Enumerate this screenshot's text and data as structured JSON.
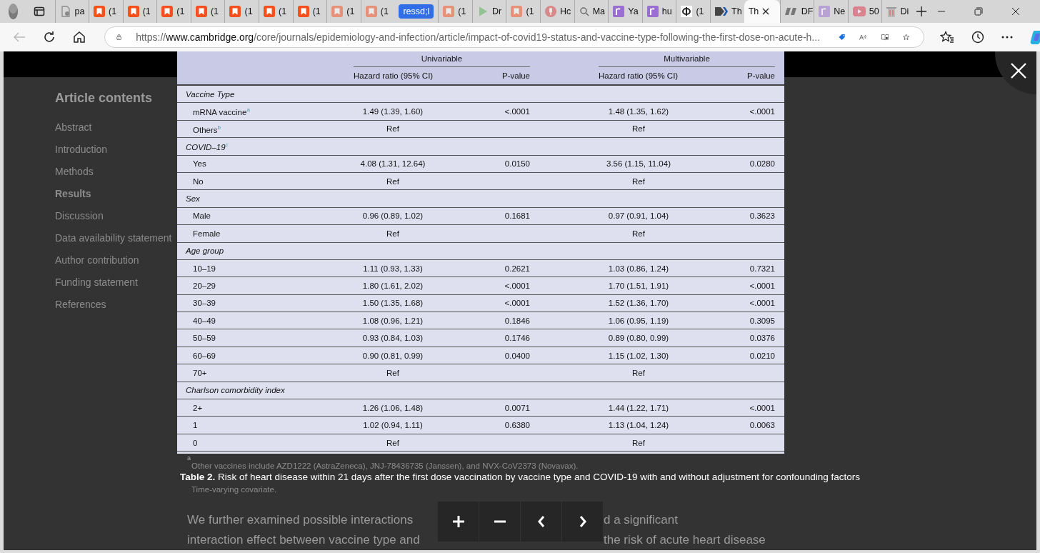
{
  "browser": {
    "tabs": [
      {
        "kind": "doc",
        "title": "pa",
        "sleeping": false,
        "selected": false
      },
      {
        "kind": "bookmark",
        "title": "(1",
        "sleeping": false,
        "selected": false
      },
      {
        "kind": "bookmark",
        "title": "(1",
        "sleeping": false,
        "selected": false
      },
      {
        "kind": "bookmark",
        "title": "(1",
        "sleeping": false,
        "selected": false
      },
      {
        "kind": "bookmark",
        "title": "(1",
        "sleeping": false,
        "selected": false
      },
      {
        "kind": "bookmark",
        "title": "(1",
        "sleeping": false,
        "selected": false
      },
      {
        "kind": "bookmark",
        "title": "(1",
        "sleeping": false,
        "selected": false
      },
      {
        "kind": "bookmark",
        "title": "(1",
        "sleeping": false,
        "selected": false
      },
      {
        "kind": "bookmark",
        "title": "(1",
        "sleeping": true,
        "selected": false
      },
      {
        "kind": "bookmark",
        "title": "(1",
        "sleeping": true,
        "selected": false
      },
      {
        "kind": "group",
        "title": "ressd;l"
      },
      {
        "kind": "bookmark",
        "title": "(1",
        "sleeping": true,
        "selected": false
      },
      {
        "kind": "play",
        "title": "Dr",
        "sleeping": true,
        "selected": false
      },
      {
        "kind": "bookmark",
        "title": "(1",
        "sleeping": true,
        "selected": false
      },
      {
        "kind": "mic",
        "title": "Hc",
        "sleeping": true,
        "selected": false
      },
      {
        "kind": "search",
        "title": "Ma",
        "sleeping": false,
        "selected": false
      },
      {
        "kind": "square",
        "title": "Ya",
        "sleeping": false,
        "selected": false
      },
      {
        "kind": "square",
        "title": "hu",
        "sleeping": false,
        "selected": false
      },
      {
        "kind": "circle",
        "title": "(1",
        "sleeping": false,
        "selected": false
      },
      {
        "kind": "arrow",
        "title": "Th",
        "sleeping": false,
        "selected": false
      },
      {
        "kind": "plain",
        "title": "Th",
        "sleeping": false,
        "selected": true
      },
      {
        "kind": "slant",
        "title": "DF",
        "sleeping": false,
        "selected": false
      },
      {
        "kind": "square",
        "title": "Ne",
        "sleeping": true,
        "selected": false
      },
      {
        "kind": "video",
        "title": "50",
        "sleeping": true,
        "selected": false
      },
      {
        "kind": "bin",
        "title": "Di",
        "sleeping": false,
        "selected": false
      }
    ],
    "back_disabled": true,
    "url": {
      "scheme": "https://",
      "host": "www.cambridge.org",
      "path": "/core/journals/epidemiology-and-infection/article/impact-of-covid19-status-and-vaccine-type-following-the-first-dose-on-acute-h..."
    }
  },
  "sidebar": {
    "title": "Article contents",
    "items": [
      {
        "label": "Abstract",
        "selected": false
      },
      {
        "label": "Introduction",
        "selected": false
      },
      {
        "label": "Methods",
        "selected": false
      },
      {
        "label": "Results",
        "selected": true
      },
      {
        "label": "Discussion",
        "selected": false
      },
      {
        "label": "Data availability statement",
        "selected": false
      },
      {
        "label": "Author contribution",
        "selected": false
      },
      {
        "label": "Funding statement",
        "selected": false
      },
      {
        "label": "References",
        "selected": false
      }
    ]
  },
  "table": {
    "groups": [
      {
        "label": "Univariable"
      },
      {
        "label": "Multivariable"
      }
    ],
    "columns": [
      "Hazard ratio (95% CI)",
      "P-value",
      "Hazard ratio (95% CI)",
      "P-value"
    ],
    "sections": [
      {
        "label": "Vaccine Type",
        "rows": [
          {
            "label": "mRNA vaccine$^{a}$",
            "cells": [
              "1.49 (1.39, 1.60)",
              "<.0001",
              "1.48 (1.35, 1.62)",
              "<.0001"
            ]
          },
          {
            "label": "Others$^{b}$",
            "cells": [
              "Ref",
              null,
              "Ref",
              null
            ]
          }
        ]
      },
      {
        "label": "COVID–19$^{c}$",
        "rows": [
          {
            "label": "Yes",
            "cells": [
              "4.08 (1.31, 12.64)",
              "0.0150",
              "3.56 (1.15, 11.04)",
              "0.0280"
            ]
          },
          {
            "label": "No",
            "cells": [
              "Ref",
              null,
              "Ref",
              null
            ]
          }
        ]
      },
      {
        "label": "Sex",
        "rows": [
          {
            "label": "Male",
            "cells": [
              "0.96 (0.89, 1.02)",
              "0.1681",
              "0.97 (0.91, 1.04)",
              "0.3623"
            ]
          },
          {
            "label": "Female",
            "cells": [
              "Ref",
              null,
              "Ref",
              null
            ]
          }
        ]
      },
      {
        "label": "Age group",
        "rows": [
          {
            "label": "10–19",
            "cells": [
              "1.11 (0.93, 1.33)",
              "0.2621",
              "1.03 (0.86, 1.24)",
              "0.7321"
            ]
          },
          {
            "label": "20–29",
            "cells": [
              "1.80 (1.61, 2.02)",
              "<.0001",
              "1.70 (1.51, 1.91)",
              "<.0001"
            ]
          },
          {
            "label": "30–39",
            "cells": [
              "1.50 (1.35, 1.68)",
              "<.0001",
              "1.52 (1.36, 1.70)",
              "<.0001"
            ]
          },
          {
            "label": "40–49",
            "cells": [
              "1.08 (0.96, 1.21)",
              "0.1846",
              "1.06 (0.95, 1.19)",
              "0.3095"
            ]
          },
          {
            "label": "50–59",
            "cells": [
              "0.93 (0.84, 1.03)",
              "0.1746",
              "0.89 (0.80, 0.99)",
              "0.0376"
            ]
          },
          {
            "label": "60–69",
            "cells": [
              "0.90 (0.81, 0.99)",
              "0.0400",
              "1.15 (1.02, 1.30)",
              "0.0210"
            ]
          },
          {
            "label": "70+",
            "cells": [
              "Ref",
              null,
              "Ref",
              null
            ]
          }
        ]
      },
      {
        "label": "Charlson comorbidity index",
        "rows": [
          {
            "label": "2+",
            "cells": [
              "1.26 (1.06, 1.48)",
              "0.0071",
              "1.44 (1.22, 1.71)",
              "<.0001"
            ]
          },
          {
            "label": "1",
            "cells": [
              "1.02 (0.94, 1.11)",
              "0.6380",
              "1.13 (1.04, 1.24)",
              "0.0063"
            ]
          },
          {
            "label": "0",
            "cells": [
              "Ref",
              null,
              "Ref",
              null
            ]
          }
        ]
      }
    ]
  },
  "footnotes": [
    {
      "mark": "a",
      "text": "Other vaccines include AZD1222 (AstraZeneca), JNJ-78436735 (Janssen), and NVX-CoV2373 (Novavax)."
    },
    {
      "text": "Time-varying covariate."
    }
  ],
  "caption": "**Table 2.** Risk of heart disease within 21 days after the first dose vaccination by vaccine type and COVID-19 with and without adjustment for confounding factors",
  "paragraph_lines": [
    {
      "left": "We further examined possible interactions",
      "right": "d a significant"
    },
    {
      "left": "interaction effect between vaccine type and",
      "right": "the risk of acute heart disease"
    }
  ]
}
